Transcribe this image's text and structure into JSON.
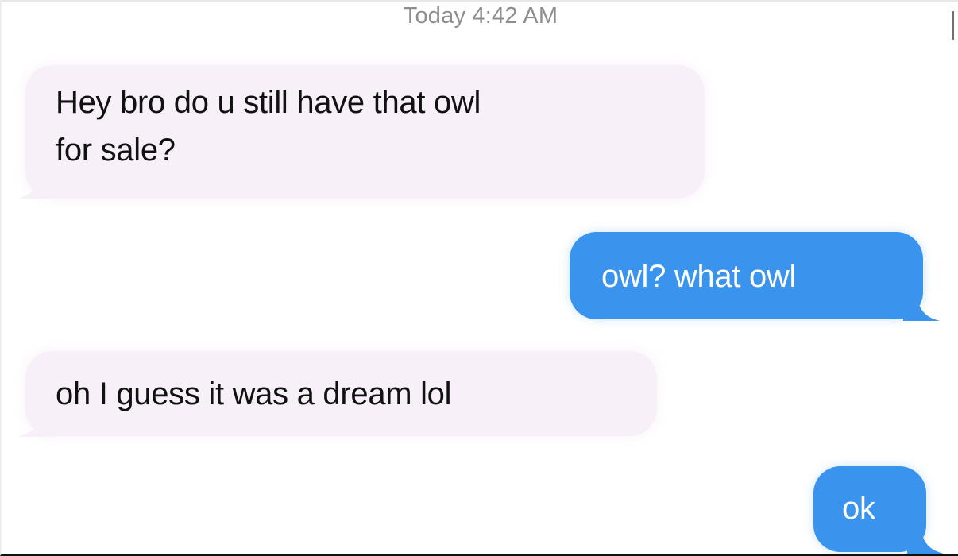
{
  "conversation": {
    "timestamp": "Today 4:42 AM",
    "messages": [
      {
        "sender": "incoming",
        "lines": [
          "Hey bro do u still have that owl",
          "for sale?"
        ]
      },
      {
        "sender": "outgoing",
        "lines": [
          "owl? what owl"
        ]
      },
      {
        "sender": "incoming",
        "lines": [
          "oh I guess it was a dream lol"
        ]
      },
      {
        "sender": "outgoing",
        "lines": [
          "ok"
        ]
      }
    ]
  },
  "colors": {
    "incoming_bubble": "#f8f0f9",
    "outgoing_bubble": "#3a93ec",
    "timestamp_text": "#8e8e8e",
    "incoming_text": "#111111",
    "outgoing_text": "#ffffff"
  }
}
